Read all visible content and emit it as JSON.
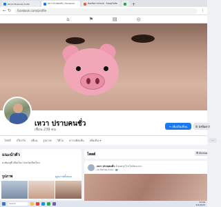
{
  "browser": {
    "tabs": [
      {
        "label": "Ghost Business Suite",
        "active": false,
        "color": "#1877f2"
      },
      {
        "label": "เหวา ปราบคนชั่ว | Facebook",
        "active": true,
        "color": "#1877f2"
      },
      {
        "label": "ห้องเปิดการเงินแอ้ - ร้อยตุยไม่คัด",
        "active": false,
        "color": "#e85d3a"
      },
      {
        "label": "",
        "active": false,
        "color": "#2ea44f"
      }
    ],
    "new_tab": "+",
    "url": "facebook.com/profile"
  },
  "fb_nav": {
    "home": "⌂",
    "flag": "⚑",
    "store": "▤",
    "groups": "◎"
  },
  "profile": {
    "name": "เหวา ปราบคนชั่ว",
    "friends": "เพื่อน 239 คน",
    "primary_button": "+ เพิ่มเป็นเพื่อน",
    "secondary_button": "✆ ส่งข้อความ"
  },
  "profile_tabs": [
    "โพสต์",
    "เกี่ยวกับ",
    "เพื่อน",
    "รูปภาพ",
    "วิดีโอ",
    "ความคิดเห็น",
    "เพิ่มเติม ▾"
  ],
  "profile_tabs_more": "···",
  "intro": {
    "title": "แนะนำตัว",
    "text": "อาศัยอยู่ที่ เขียงใหม่ จังหวัดเชียงใหม่"
  },
  "photos": {
    "title": "รูปภาพ",
    "link": "ดูรูปภาพทั้งหมด"
  },
  "posts": {
    "title": "โพสต์",
    "filter": "☰ ตัวกรอง",
    "author": "เหวา ปราบคนชั่ว",
    "action": " อัปเดตรูปโปรไฟล์ของเขา",
    "date": "26 สิงหาคม 2022 · 👥"
  },
  "taskbar": {
    "search": "Search",
    "time": "12:09",
    "date": "5/2/2025"
  }
}
